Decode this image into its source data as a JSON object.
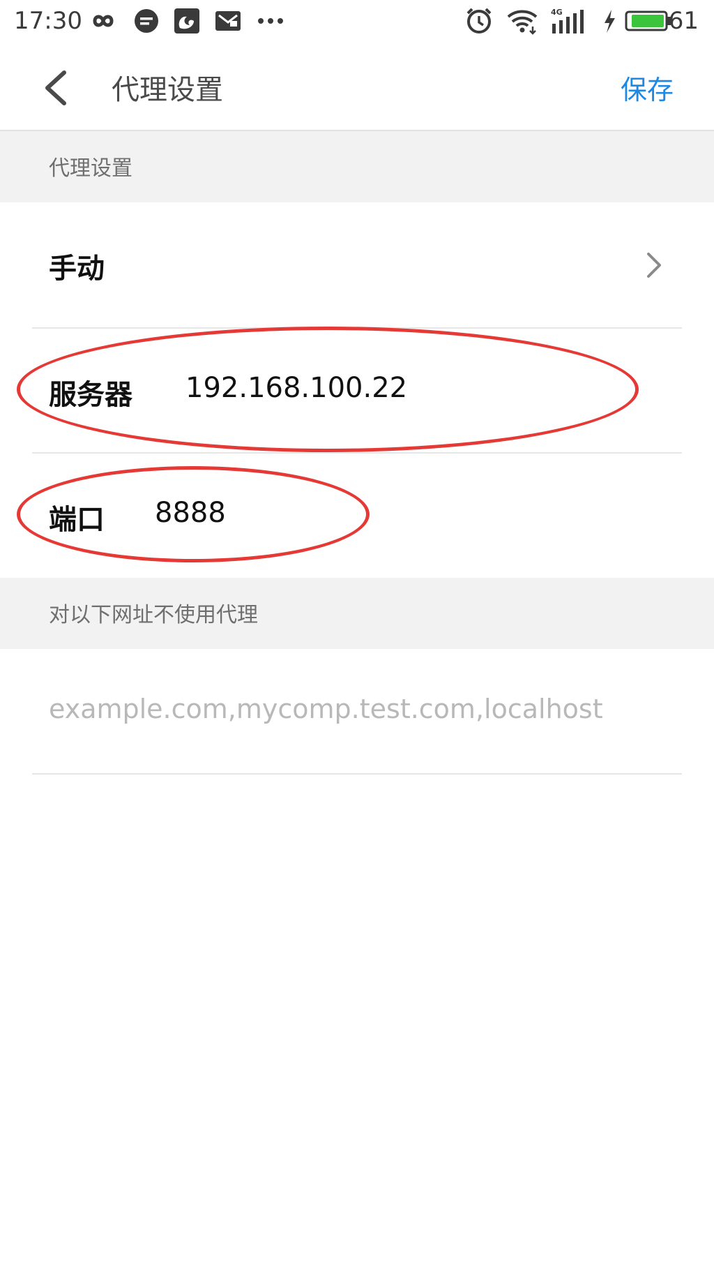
{
  "status_bar": {
    "time": "17:30",
    "icons": [
      "infinity-icon",
      "chat-bubble-icon",
      "uc-browser-icon",
      "image-mail-icon",
      "more-dots-icon",
      "alarm-icon",
      "wifi-icon",
      "signal-4g-icon",
      "charging-bolt-icon",
      "battery-icon"
    ],
    "battery_percent": "61",
    "network": "4G",
    "battery_color": "#3cc43c"
  },
  "app_bar": {
    "title": "代理设置",
    "save_label": "保存",
    "accent_color": "#1e88e5"
  },
  "sections": {
    "proxy_header": "代理设置",
    "bypass_header": "对以下网址不使用代理"
  },
  "proxy": {
    "mode_label": "手动",
    "server_label": "服务器",
    "server_value": "192.168.100.22",
    "port_label": "端口",
    "port_value": "8888"
  },
  "bypass": {
    "placeholder": "example.com,mycomp.test.com,localhost"
  },
  "annotations": {
    "color": "#e53935"
  }
}
